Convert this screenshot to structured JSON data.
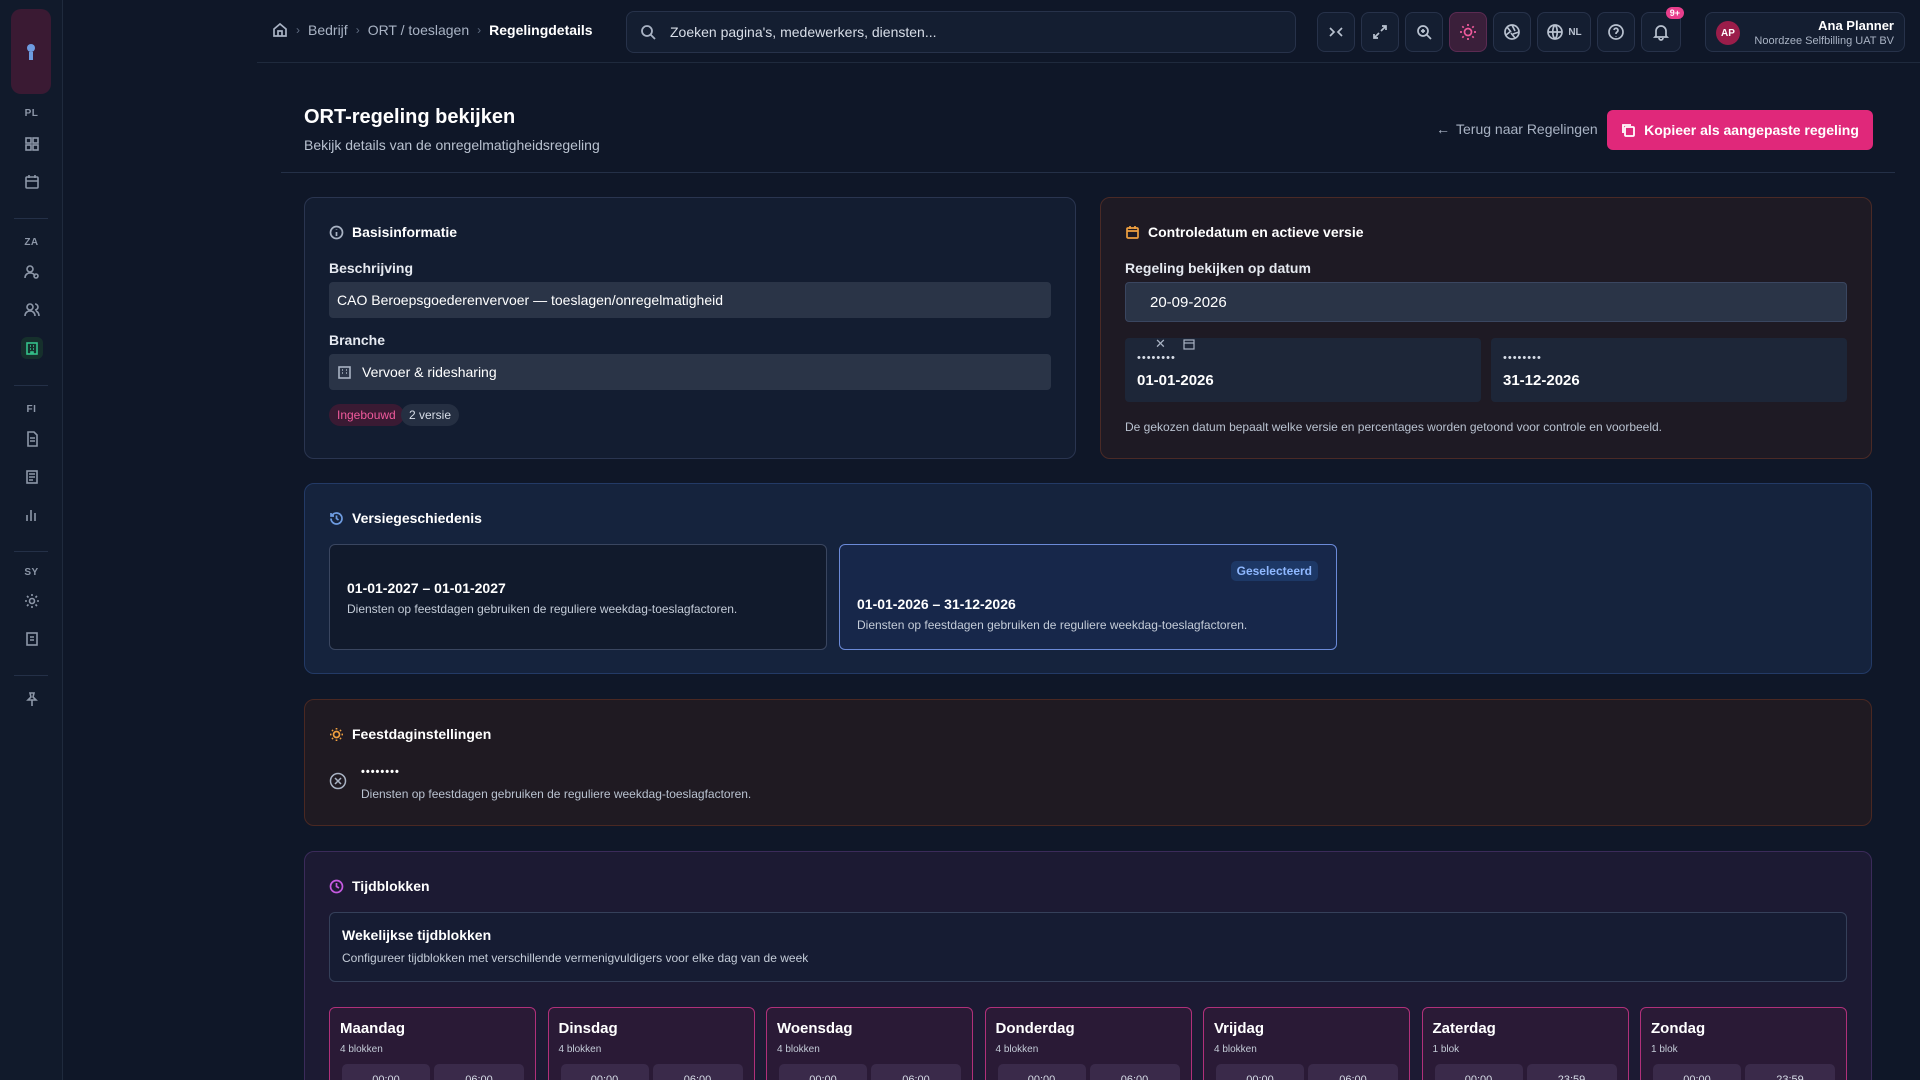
{
  "header": {
    "breadcrumbs": [
      "Bedrijf",
      "ORT / toeslagen",
      "Regelingdetails"
    ],
    "search_placeholder": "Zoeken pagina's, medewerkers, diensten...",
    "language": "NL",
    "notifications": "9+",
    "user": {
      "initials": "AP",
      "name": "Ana Planner",
      "org": "Noordzee Selfbilling UAT BV"
    }
  },
  "sidebar": {
    "sections": [
      "PL",
      "ZA",
      "FI",
      "SY"
    ]
  },
  "page": {
    "title": "ORT-regeling bekijken",
    "subtitle": "Bekijk details van de onregelmatigheidsregeling",
    "back_label": "Terug naar Regelingen",
    "copy_label": "Kopieer als aangepaste regeling"
  },
  "basis": {
    "title": "Basisinformatie",
    "desc_label": "Beschrijving",
    "desc_value": "CAO Beroepsgoederenvervoer — toeslagen/onregelmatigheid",
    "branch_label": "Branche",
    "branch_value": "Vervoer & ridesharing",
    "tags": [
      "Ingebouwd",
      "2 versie"
    ]
  },
  "control": {
    "title": "Controledatum en actieve versie",
    "date_label": "Regeling bekijken op datum",
    "date_value": "20-09-2026",
    "start_mask": "••••••••",
    "start": "01-01-2026",
    "end_mask": "••••••••",
    "end": "31-12-2026",
    "note": "De gekozen datum bepaalt welke versie en percentages worden getoond voor controle en voorbeeld."
  },
  "history": {
    "title": "Versiegeschiedenis",
    "selected_tag": "Geselecteerd",
    "versions": [
      {
        "range": "01-01-2027 – 01-01-2027",
        "desc": "Diensten op feestdagen gebruiken de reguliere weekdag-toeslagfactoren."
      },
      {
        "range": "01-01-2026 – 31-12-2026",
        "desc": "Diensten op feestdagen gebruiken de reguliere weekdag-toeslagfactoren."
      }
    ]
  },
  "holiday": {
    "title": "Feestdaginstellingen",
    "mask": "••••••••",
    "desc": "Diensten op feestdagen gebruiken de reguliere weekdag-toeslagfactoren."
  },
  "blocks": {
    "title": "Tijdblokken",
    "weekly_title": "Wekelijkse tijdblokken",
    "weekly_desc": "Configureer tijdblokken met verschillende vermenigvuldigers voor elke dag van de week",
    "days": [
      {
        "name": "Maandag",
        "count": "4 blokken",
        "a": "00:00",
        "b": "06:00"
      },
      {
        "name": "Dinsdag",
        "count": "4 blokken",
        "a": "00:00",
        "b": "06:00"
      },
      {
        "name": "Woensdag",
        "count": "4 blokken",
        "a": "00:00",
        "b": "06:00"
      },
      {
        "name": "Donderdag",
        "count": "4 blokken",
        "a": "00:00",
        "b": "06:00"
      },
      {
        "name": "Vrijdag",
        "count": "4 blokken",
        "a": "00:00",
        "b": "06:00"
      },
      {
        "name": "Zaterdag",
        "count": "1 blok",
        "a": "00:00",
        "b": "23:59"
      },
      {
        "name": "Zondag",
        "count": "1 blok",
        "a": "00:00",
        "b": "23:59"
      }
    ]
  }
}
